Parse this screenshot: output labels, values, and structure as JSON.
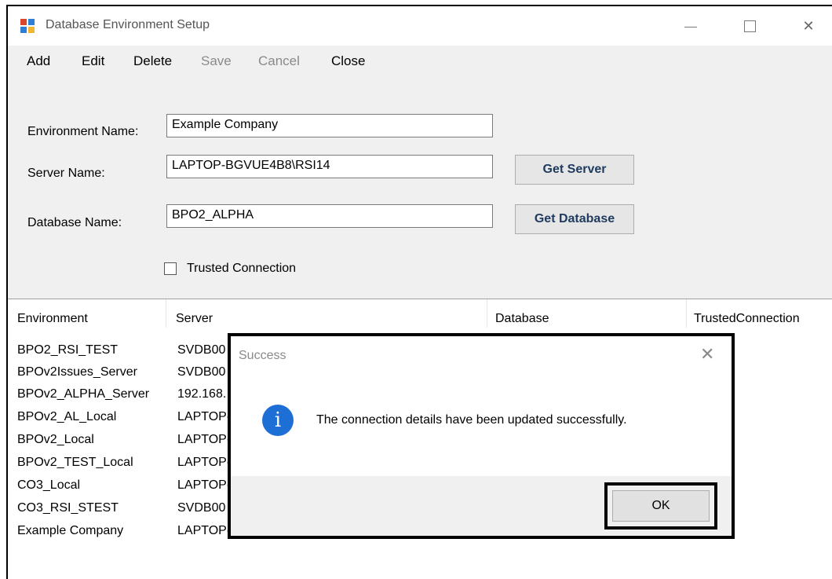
{
  "window": {
    "title": "Database Environment Setup"
  },
  "menu": {
    "add": "Add",
    "edit": "Edit",
    "delete": "Delete",
    "save": "Save",
    "cancel": "Cancel",
    "close": "Close"
  },
  "form": {
    "environment_label": "Environment Name:",
    "environment_value": "Example Company",
    "server_label": "Server Name:",
    "server_value": "LAPTOP-BGVUE4B8\\RSI14",
    "database_label": "Database Name:",
    "database_value": "BPO2_ALPHA",
    "get_server": "Get Server",
    "get_database": "Get Database",
    "trusted_label": "Trusted Connection",
    "trusted_checked": false
  },
  "list": {
    "columns": [
      "Environment",
      "Server",
      "Database",
      "TrustedConnection"
    ],
    "rows": [
      {
        "environment": "BPO2_RSI_TEST",
        "server": "SVDB00"
      },
      {
        "environment": "BPOv2Issues_Server",
        "server": "SVDB00"
      },
      {
        "environment": "BPOv2_ALPHA_Server",
        "server": "192.168."
      },
      {
        "environment": "BPOv2_AL_Local",
        "server": "LAPTOP-"
      },
      {
        "environment": "BPOv2_Local",
        "server": "LAPTOP-"
      },
      {
        "environment": "BPOv2_TEST_Local",
        "server": "LAPTOP-"
      },
      {
        "environment": "CO3_Local",
        "server": "LAPTOP-"
      },
      {
        "environment": "CO3_RSI_STEST",
        "server": "SVDB00"
      },
      {
        "environment": "Example Company",
        "server": "LAPTOP-"
      }
    ]
  },
  "dialog": {
    "title": "Success",
    "message": "The connection details have been updated successfully.",
    "ok": "OK",
    "icon": "info-icon",
    "icon_color": "#1d6fd6"
  }
}
